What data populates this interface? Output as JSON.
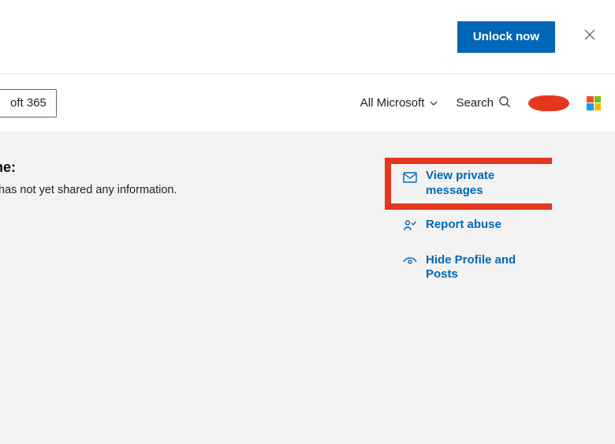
{
  "banner": {
    "unlock_label": "Unlock now"
  },
  "nav": {
    "product_label": "oft 365",
    "all_microsoft_label": "All Microsoft",
    "search_label": "Search"
  },
  "content": {
    "about_heading": "ut me:",
    "about_text": "has not yet shared any information."
  },
  "actions": {
    "view_messages": "View private messages",
    "report_abuse": "Report abuse",
    "hide_profile": "Hide Profile and Posts"
  }
}
